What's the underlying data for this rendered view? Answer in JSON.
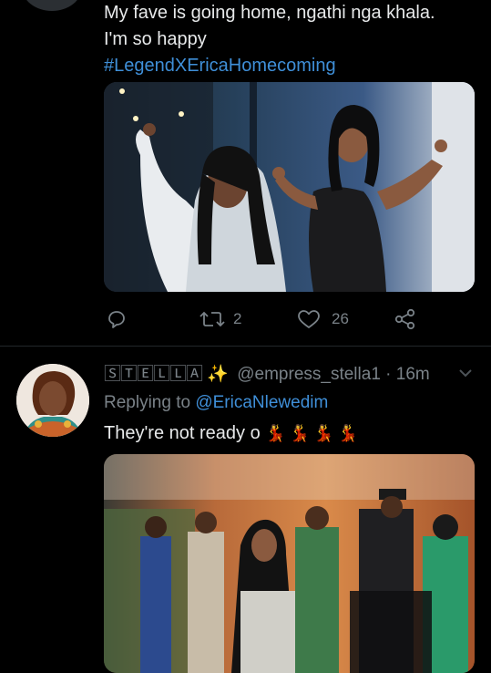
{
  "tweet1": {
    "line1": "My fave is going home, ngathi nga khala.",
    "line2": "I'm so happy",
    "hashtag": "#LegendXEricaHomecoming",
    "retweet_count": "2",
    "like_count": "26"
  },
  "tweet2": {
    "display_name": "🅂🅃🄴🄻🄻🄰",
    "display_name_emoji": "✨",
    "handle": "@empress_stella1",
    "separator": "·",
    "time": "16m",
    "replying_prefix": "Replying to",
    "replying_to": "@EricaNlewedim",
    "text": "They're not ready o",
    "text_emojis": "💃💃💃💃"
  },
  "colors": {
    "background": "#000000",
    "link": "#3f8fd8",
    "muted": "#7a8288",
    "text": "#e7e9ea"
  },
  "icons": [
    "reply-icon",
    "retweet-icon",
    "like-icon",
    "share-icon",
    "chevron-down-icon",
    "sparkles-icon",
    "dancer-icon"
  ]
}
